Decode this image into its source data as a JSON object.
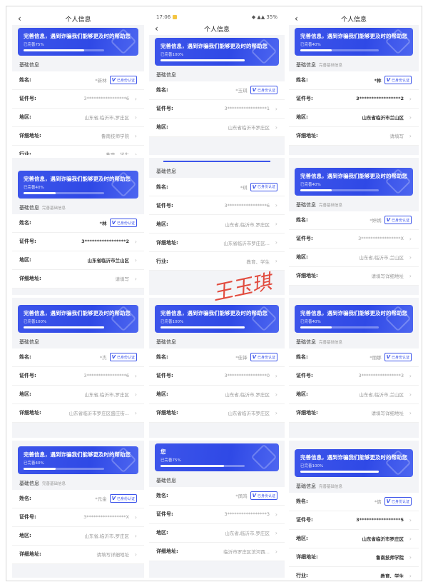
{
  "banner_message": "完善信息，遇到诈骗我们能够更及时的帮助您",
  "section_title": "基础信息",
  "section_subtitle": "完善基础信息",
  "badge_label": "已身份认证",
  "nav_title": "个人信息",
  "colors": {
    "banner": "#2f49e6",
    "accent": "#3d55ea",
    "signature": "#e0392b"
  },
  "tiles": [
    {
      "nav": "个人信息",
      "progress_label": "已完善75%",
      "progress": 0.75,
      "show_sub": false,
      "rows": [
        {
          "label": "姓名:",
          "value": "*新林",
          "badge": true,
          "dark": false
        },
        {
          "label": "证件号:",
          "value": "3*****************6",
          "badge": false,
          "dark": false
        },
        {
          "label": "地区:",
          "value": "山东省,临沂市,罗庄区",
          "badge": false,
          "dark": false
        },
        {
          "label": "详细地址:",
          "value": "鲁南技师学院",
          "badge": false,
          "dark": false
        },
        {
          "label": "行业:",
          "value": "教育、学生",
          "badge": false,
          "dark": false
        }
      ]
    },
    {
      "status_time": "17:06",
      "status_battery": "35%",
      "nav": "个人信息",
      "progress_label": "已完善100%",
      "progress": 1.0,
      "show_sub": false,
      "rows": [
        {
          "label": "姓名:",
          "value": "*玉琪",
          "badge": true,
          "dark": false
        },
        {
          "label": "证件号:",
          "value": "3*****************1",
          "badge": false,
          "dark": false
        },
        {
          "label": "地区:",
          "value": "山东省临沂市罗庄区",
          "badge": false,
          "dark": false
        }
      ]
    },
    {
      "nav": "个人信息",
      "progress_label": "已完善40%",
      "progress": 0.4,
      "show_sub": true,
      "rows": [
        {
          "label": "姓名:",
          "value": "*林",
          "badge": true,
          "dark": true
        },
        {
          "label": "证件号:",
          "value": "3*****************2",
          "badge": false,
          "dark": true
        },
        {
          "label": "地区:",
          "value": "山东省临沂市兰山区",
          "badge": false,
          "dark": true
        },
        {
          "label": "详细地址:",
          "value": "请填写",
          "badge": false,
          "dark": false
        }
      ]
    },
    {
      "nav": "个人信息",
      "progress_label": "已完善40%",
      "progress": 0.4,
      "show_sub": true,
      "rows": [
        {
          "label": "姓名:",
          "value": "*林",
          "badge": true,
          "dark": true
        },
        {
          "label": "证件号:",
          "value": "3*****************2",
          "badge": false,
          "dark": true
        },
        {
          "label": "地区:",
          "value": "山东省临沂市兰山区",
          "badge": false,
          "dark": true
        },
        {
          "label": "详细地址:",
          "value": "请填写",
          "badge": false,
          "dark": false
        }
      ]
    },
    {
      "nav": "",
      "progress_label": "",
      "progress": null,
      "show_sub": false,
      "rows": [
        {
          "label": "姓名:",
          "value": "*琪",
          "badge": true,
          "dark": false
        },
        {
          "label": "证件号:",
          "value": "3*****************6",
          "badge": false,
          "dark": false
        },
        {
          "label": "地区:",
          "value": "山东省,临沂市,罗庄区",
          "badge": false,
          "dark": false
        },
        {
          "label": "详细地址:",
          "value": "山东省临沂市罗庄区...",
          "badge": false,
          "dark": false
        },
        {
          "label": "行业:",
          "value": "教育、学生",
          "badge": false,
          "dark": false
        }
      ]
    },
    {
      "nav": "",
      "progress_label": "已完善40%",
      "progress": 0.4,
      "show_sub": true,
      "rows": [
        {
          "label": "姓名:",
          "value": "*婷嫣",
          "badge": true,
          "dark": false
        },
        {
          "label": "证件号:",
          "value": "3*****************X",
          "badge": false,
          "dark": false
        },
        {
          "label": "地区:",
          "value": "山东省,临沂市,兰山区",
          "badge": false,
          "dark": false
        },
        {
          "label": "详细地址:",
          "value": "请填写详细地址",
          "badge": false,
          "dark": false
        }
      ]
    },
    {
      "nav": "",
      "progress_label": "已完善100%",
      "progress": 1.0,
      "show_sub": false,
      "rows": [
        {
          "label": "姓名:",
          "value": "*杰",
          "badge": true,
          "dark": false
        },
        {
          "label": "证件号:",
          "value": "3*****************6",
          "badge": false,
          "dark": false
        },
        {
          "label": "地区:",
          "value": "山东省,临沂市,罗庄区",
          "badge": false,
          "dark": false
        },
        {
          "label": "详细地址:",
          "value": "山东省临沂市罗庄区盛庄街...",
          "badge": false,
          "dark": false
        }
      ]
    },
    {
      "nav": "",
      "progress_label": "已完善100%",
      "progress": 1.0,
      "show_sub": false,
      "rows": [
        {
          "label": "姓名:",
          "value": "*佳锋",
          "badge": true,
          "dark": false
        },
        {
          "label": "证件号:",
          "value": "3*****************0",
          "badge": false,
          "dark": false
        },
        {
          "label": "地区:",
          "value": "山东省,临沂市,罗庄区",
          "badge": false,
          "dark": false
        },
        {
          "label": "详细地址:",
          "value": "山东省临沂市罗庄区",
          "badge": false,
          "dark": false
        }
      ]
    },
    {
      "nav": "",
      "progress_label": "已完善40%",
      "progress": 0.4,
      "show_sub": true,
      "rows": [
        {
          "label": "姓名:",
          "value": "*丽娜",
          "badge": true,
          "dark": false
        },
        {
          "label": "证件号:",
          "value": "3*****************3",
          "badge": false,
          "dark": false
        },
        {
          "label": "地区:",
          "value": "山东省,临沂市,兰山区",
          "badge": false,
          "dark": false
        },
        {
          "label": "详细地址:",
          "value": "请填写详细地址",
          "badge": false,
          "dark": false
        }
      ]
    },
    {
      "nav": "",
      "progress_label": "已完善40%",
      "progress": 0.4,
      "show_sub": true,
      "rows": [
        {
          "label": "姓名:",
          "value": "*元金",
          "badge": true,
          "dark": false
        },
        {
          "label": "证件号:",
          "value": "3*****************X",
          "badge": false,
          "dark": false
        },
        {
          "label": "地区:",
          "value": "山东省,临沂市,罗庄区",
          "badge": false,
          "dark": false
        },
        {
          "label": "详细地址:",
          "value": "请填写详细地址",
          "badge": false,
          "dark": false
        }
      ]
    },
    {
      "nav": "",
      "progress_label": "已完善75%",
      "progress": 0.75,
      "show_sub": false,
      "banner_override": "您",
      "rows": [
        {
          "label": "姓名:",
          "value": "*凤鸣",
          "badge": true,
          "dark": false
        },
        {
          "label": "证件号:",
          "value": "3*****************3",
          "badge": false,
          "dark": false
        },
        {
          "label": "地区:",
          "value": "山东省,临沂市,罗庄区",
          "badge": false,
          "dark": false
        },
        {
          "label": "详细地址:",
          "value": "临沂市罗庄区滨河西...",
          "badge": false,
          "dark": false
        }
      ]
    },
    {
      "nav": "",
      "progress_label": "已完善100%",
      "progress": 1.0,
      "show_sub": true,
      "rows": [
        {
          "label": "姓名:",
          "value": "*倩",
          "badge": true,
          "dark": false
        },
        {
          "label": "证件号:",
          "value": "3*****************5",
          "badge": false,
          "dark": true
        },
        {
          "label": "地区:",
          "value": "山东省临沂市罗庄区",
          "badge": false,
          "dark": true
        },
        {
          "label": "详细地址:",
          "value": "鲁南技师学院",
          "badge": false,
          "dark": true
        },
        {
          "label": "行业:",
          "value": "教育、学生",
          "badge": false,
          "dark": true
        }
      ]
    }
  ],
  "signature": "王玉琪"
}
